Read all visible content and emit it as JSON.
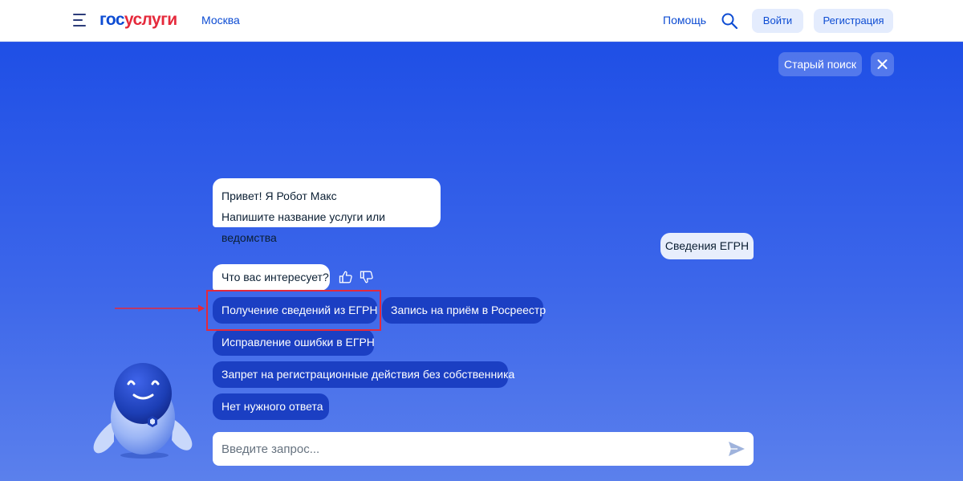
{
  "header": {
    "logo_part1": "гос",
    "logo_part2": "услуги",
    "city": "Москва",
    "help_label": "Помощь",
    "login_label": "Войти",
    "register_label": "Регистрация"
  },
  "toolbar": {
    "old_search_label": "Старый поиск"
  },
  "chat": {
    "bot_greeting_line1": "Привет! Я Робот Макс",
    "bot_greeting_line2": "Напишите название услуги или ведомства",
    "user_message": "Сведения ЕГРН",
    "bot_question": "Что вас интересует?",
    "options": [
      "Получение сведений из ЕГРН",
      "Запись на приём в Росреестр",
      "Исправление ошибки в ЕГРН",
      "Запрет на регистрационные действия без собственника",
      "Нет нужного ответа"
    ]
  },
  "input": {
    "placeholder": "Введите запрос..."
  },
  "colors": {
    "brand_blue": "#0d4cd3",
    "brand_red": "#e5293b",
    "background": "#2a55e6",
    "chip": "#1b3fc3",
    "highlight": "#e5293b"
  },
  "icons": [
    "menu-icon",
    "search-icon",
    "close-icon",
    "thumbs-up-icon",
    "thumbs-down-icon",
    "send-icon",
    "robot-avatar",
    "arrow-annotation"
  ]
}
